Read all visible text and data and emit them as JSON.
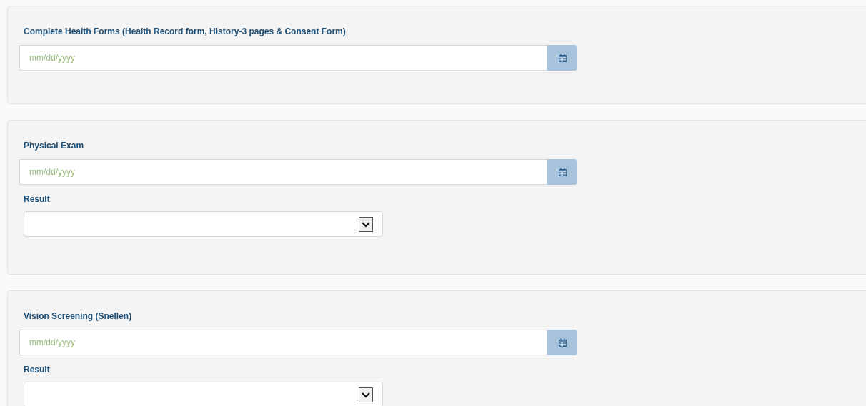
{
  "sections": [
    {
      "title": "Complete Health Forms (Health Record form, History-3 pages & Consent Form)",
      "date_placeholder": "mm/dd/yyyy"
    },
    {
      "title": "Physical Exam",
      "date_placeholder": "mm/dd/yyyy",
      "result": {
        "label": "Result"
      }
    },
    {
      "title": "Vision Screening (Snellen)",
      "date_placeholder": "mm/dd/yyyy",
      "result": {
        "label": "Result"
      }
    }
  ]
}
